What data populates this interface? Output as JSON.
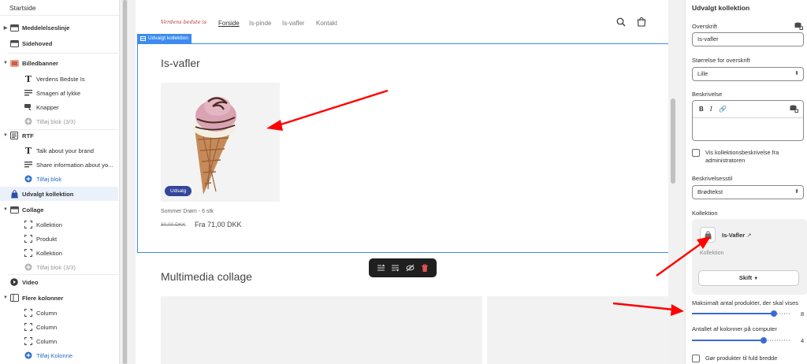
{
  "sidebar": {
    "title": "Startside",
    "items": [
      {
        "label": "Meddelelseslinje"
      },
      {
        "label": "Sidehoved"
      },
      {
        "label": "Billedbanner"
      },
      {
        "label": "Verdens Bedste Is"
      },
      {
        "label": "Smagen af lykke"
      },
      {
        "label": "Knapper"
      },
      {
        "label": "Tilføj blok (3/3)"
      },
      {
        "label": "RTF"
      },
      {
        "label": "Talk about your brand"
      },
      {
        "label": "Share information about yo..."
      },
      {
        "label": "Tilføj blok"
      },
      {
        "label": "Udvalgt kollektion"
      },
      {
        "label": "Collage"
      },
      {
        "label": "Kollektion"
      },
      {
        "label": "Produkt"
      },
      {
        "label": "Kollektion"
      },
      {
        "label": "Tilføj blok (3/3)"
      },
      {
        "label": "Video"
      },
      {
        "label": "Flere kolonner"
      },
      {
        "label": "Column"
      },
      {
        "label": "Column"
      },
      {
        "label": "Column"
      },
      {
        "label": "Tilføj Kolonne"
      }
    ]
  },
  "preview": {
    "logo": "Verdens bedste is",
    "nav": [
      "Forside",
      "Is-pinde",
      "Is-vafler",
      "Kontakt"
    ],
    "section_tag": "Udvalgt kollektion",
    "section_title": "Is-vafler",
    "product": {
      "badge": "Udsalg",
      "name": "Sommer Drøm - 6 stk",
      "old_price": "80,00 DKK",
      "price": "Fra 71,00 DKK"
    },
    "next_section_title": "Multimedia collage"
  },
  "panel": {
    "title": "Udvalgt kollektion",
    "heading_label": "Overskrift",
    "heading_value": "Is-vafler",
    "heading_size_label": "Størrelse for overskrift",
    "heading_size_value": "Lille",
    "description_label": "Beskrivelse",
    "show_desc_label": "Vis kollektionsbeskrivelse fra administratoren",
    "desc_style_label": "Beskrivelsesstil",
    "desc_style_value": "Brødtekst",
    "collection_label": "Kollektion",
    "collection_name": "Is-Vafler",
    "collection_type": "Kollektion",
    "change_button": "Skift",
    "max_products_label": "Maksimalt antal produkter, der skal vises",
    "max_products_value": "8",
    "max_products_fraction": 0.833,
    "columns_label": "Antallet af kolonner på computer",
    "columns_value": "4",
    "columns_fraction": 0.73,
    "full_width_label": "Gør produkter til fuld bredde"
  },
  "colors": {
    "selection": "#3d8bf2",
    "accent": "#3a6bd1",
    "badge": "#33469a",
    "annotation_arrow": "#ff0000"
  }
}
